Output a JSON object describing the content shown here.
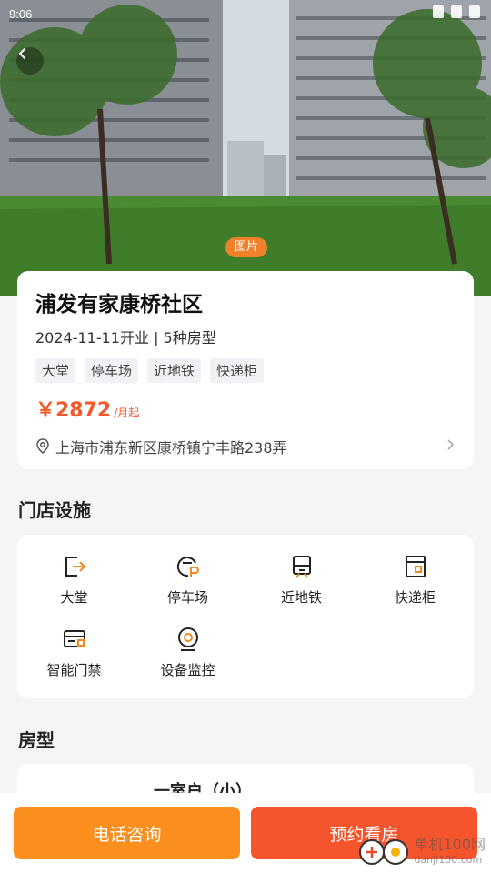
{
  "status": {
    "time": "9:06"
  },
  "hero": {
    "badge": "图片"
  },
  "info": {
    "title": "浦发有家康桥社区",
    "subtitle": "2024-11-11开业 | 5种房型",
    "tags": [
      "大堂",
      "停车场",
      "近地铁",
      "快递柜"
    ],
    "price": "￥2872",
    "price_unit": "/月起",
    "address": "上海市浦东新区康桥镇宁丰路238弄"
  },
  "facilities": {
    "title": "门店设施",
    "items": [
      {
        "label": "大堂",
        "icon": "lobby-icon"
      },
      {
        "label": "停车场",
        "icon": "parking-icon"
      },
      {
        "label": "近地铁",
        "icon": "metro-icon"
      },
      {
        "label": "快递柜",
        "icon": "locker-icon"
      },
      {
        "label": "智能门禁",
        "icon": "access-card-icon"
      },
      {
        "label": "设备监控",
        "icon": "camera-icon"
      }
    ]
  },
  "rooms": {
    "title": "房型",
    "first_name": "一室户（小）"
  },
  "actions": {
    "call": "电话咨询",
    "book": "预约看房"
  },
  "watermark": {
    "name": "单机100网",
    "url": "danji100.com"
  },
  "colors": {
    "accent_orange": "#fb8f1d",
    "accent_red": "#f4552c",
    "price": "#f25a2c"
  }
}
